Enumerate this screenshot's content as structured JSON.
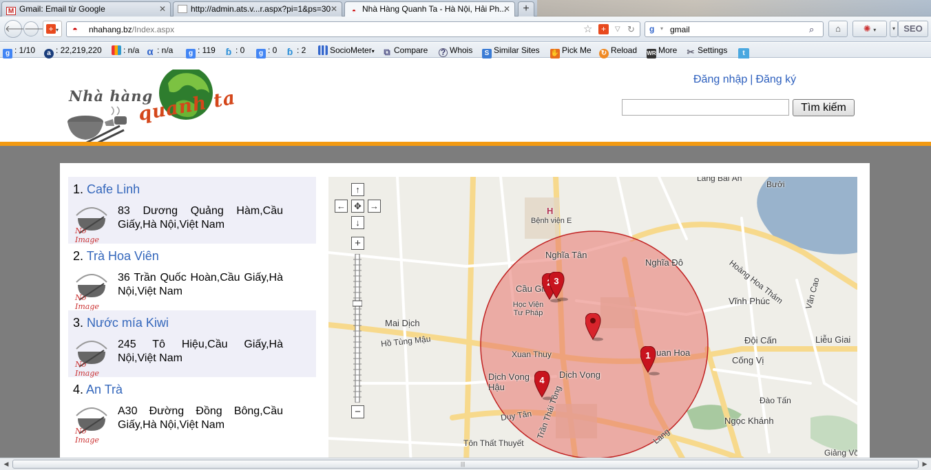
{
  "browser": {
    "tabs": [
      {
        "title": "Gmail: Email từ Google",
        "icon": "gmail-icon"
      },
      {
        "title": "http://admin.ats.v...r.aspx?pi=1&ps=30",
        "icon": "blank-page-icon"
      },
      {
        "title": "Nhà Hàng Quanh Ta - Hà Nội, Hải Ph...",
        "icon": "bowl-icon"
      }
    ],
    "url_domain": "nhahang.bz",
    "url_path": "/Index.aspx",
    "search_value": "gmail",
    "seo_label": "SEO"
  },
  "extensions": [
    {
      "label": ": 1/10",
      "icon": "google-pagerank-icon"
    },
    {
      "label": ": 22,219,220",
      "icon": "alexa-rank-icon"
    },
    {
      "label": ": n/a",
      "icon": "dmoz-icon"
    },
    {
      "label": ": n/a",
      "icon": "alpha-icon"
    },
    {
      "label": ": 119",
      "icon": "google-index-icon"
    },
    {
      "label": ": 0",
      "icon": "bing-index-icon"
    },
    {
      "label": ": 0",
      "icon": "google-backlinks-icon"
    },
    {
      "label": ": 2",
      "icon": "bing-backlinks-icon"
    },
    {
      "label": "SocioMeter",
      "icon": "sociometer-icon"
    },
    {
      "label": "Compare",
      "icon": "compare-icon"
    },
    {
      "label": "Whois",
      "icon": "whois-icon"
    },
    {
      "label": "Similar Sites",
      "icon": "similar-sites-icon"
    },
    {
      "label": "Pick Me",
      "icon": "pick-me-icon"
    },
    {
      "label": "Reload",
      "icon": "reload-icon"
    },
    {
      "label": "More",
      "icon": "more-icon"
    },
    {
      "label": "Settings",
      "icon": "settings-icon"
    }
  ],
  "site": {
    "logo_line1": "Nhà hàng",
    "logo_line2": "quanh ta",
    "login_label": "Đăng nhập",
    "separator": "|",
    "register_label": "Đăng ký",
    "search_button": "Tìm kiếm",
    "no_image": "No Image"
  },
  "results": [
    {
      "num": "1.",
      "name": "Cafe Linh",
      "address": "83 Dương Quảng Hàm,Cầu Giấy,Hà Nội,Việt Nam"
    },
    {
      "num": "2.",
      "name": "Trà Hoa Viên",
      "address": "36 Trần Quốc Hoàn,Cầu Giấy,Hà Nội,Việt Nam"
    },
    {
      "num": "3.",
      "name": "Nước mía Kiwi",
      "address": "245 Tô Hiệu,Cầu Giấy,Hà Nội,Việt Nam"
    },
    {
      "num": "4.",
      "name": "An Trà",
      "address": "A30 Đường Đồng Bông,Cầu Giấy,Hà Nội,Việt Nam"
    }
  ],
  "map": {
    "labels": [
      "Làng Bái Ân",
      "Bưởi",
      "Bệnh viện E",
      "Nghĩa Tân",
      "Nghĩa Đô",
      "Hoàng Hoa Thám",
      "Cầu Giấy",
      "Học Viện Tư Pháp",
      "Mai Dịch",
      "Hồ Tùng Mậu",
      "Vĩnh Phúc",
      "Văn Cao",
      "Đội Cấn",
      "Liễu Giai",
      "Cống Vị",
      "Xuan Thuy",
      "Quan Hoa",
      "Dịch Vọng Hậu",
      "Dịch Vọng",
      "Duy Tân",
      "Trần Thái Tông",
      "Đào Tấn",
      "Ngọc Khánh",
      "Tôn Thất Thuyết",
      "Giảng Võ",
      "Lang"
    ],
    "hospital_mark": "H",
    "markers": [
      "1",
      "2",
      "3",
      "4"
    ],
    "circle_color": "#e8756b"
  }
}
